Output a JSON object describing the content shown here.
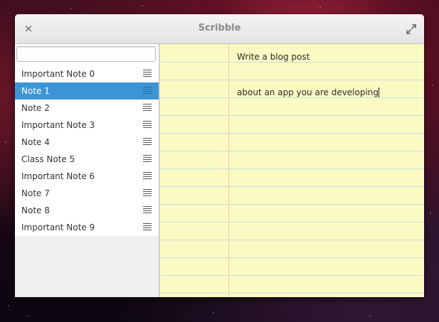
{
  "window": {
    "title": "Scribble"
  },
  "titlebar": {
    "close_icon": "×",
    "maximize_icon": "expand-arrows"
  },
  "sidebar": {
    "search": {
      "value": "",
      "placeholder": ""
    },
    "notes": [
      {
        "label": "Important Note 0",
        "selected": false
      },
      {
        "label": "Note 1",
        "selected": true
      },
      {
        "label": "Note 2",
        "selected": false
      },
      {
        "label": "Important Note 3",
        "selected": false
      },
      {
        "label": "Note 4",
        "selected": false
      },
      {
        "label": "Class Note 5",
        "selected": false
      },
      {
        "label": "Important Note 6",
        "selected": false
      },
      {
        "label": "Note 7",
        "selected": false
      },
      {
        "label": "Note 8",
        "selected": false
      },
      {
        "label": "Important Note 9",
        "selected": false
      }
    ]
  },
  "editor": {
    "lines": [
      "Write a blog post",
      "about an app you are developing"
    ]
  },
  "colors": {
    "selection": "#3d95d6",
    "paper": "#fbfac3",
    "rule_line": "#c9dbe3",
    "margin_line": "#ecc9b8"
  }
}
